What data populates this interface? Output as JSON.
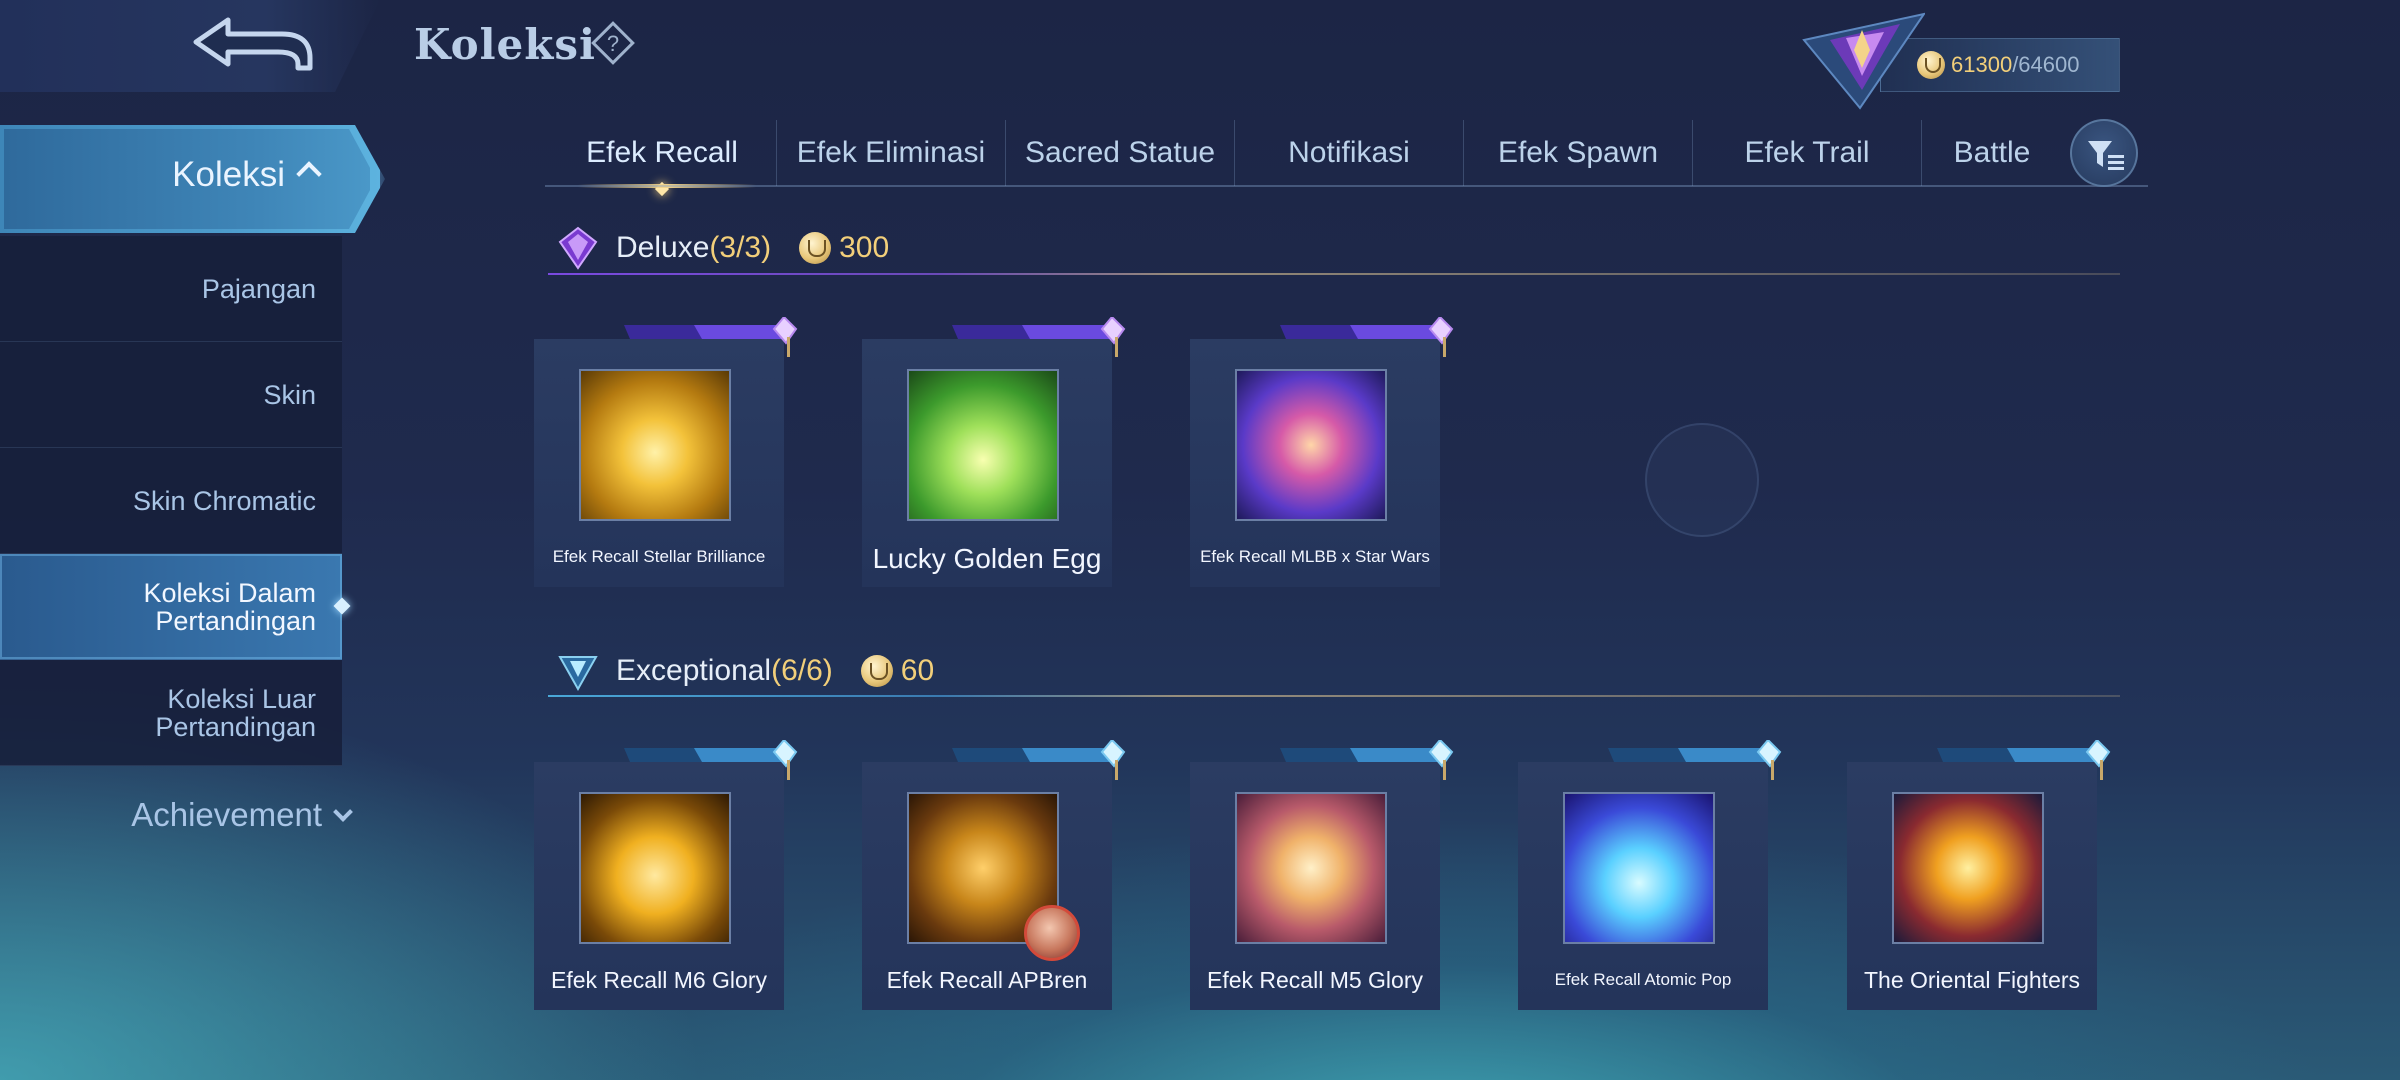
{
  "header": {
    "title": "Koleksi",
    "points_current": "61300",
    "points_max": "/64600"
  },
  "sidebar": {
    "main_label": "Koleksi",
    "items": [
      {
        "label": "Pajangan"
      },
      {
        "label": "Skin"
      },
      {
        "label": "Skin Chromatic"
      },
      {
        "label": "Koleksi Dalam Pertandingan",
        "active": true
      },
      {
        "label": "Koleksi Luar Pertandingan"
      }
    ],
    "achievement_label": "Achievement"
  },
  "tabs": [
    "Efek Recall",
    "Efek Eliminasi",
    "Sacred Statue",
    "Notifikasi",
    "Efek Spawn",
    "Efek Trail",
    "Battle"
  ],
  "active_tab": "Efek Recall",
  "sections": [
    {
      "name": "Deluxe",
      "count": "(3/3)",
      "cost": "300",
      "accent": "#8a5ad8",
      "items": [
        {
          "label": "Efek Recall Stellar Brilliance",
          "icon": "golden-swirl"
        },
        {
          "label": "Lucky Golden Egg",
          "icon": "golden-egg"
        },
        {
          "label": "Efek Recall MLBB x Star Wars",
          "icon": "crossed-lightsabers"
        }
      ]
    },
    {
      "name": "Exceptional",
      "count": "(6/6)",
      "cost": "60",
      "accent": "#4aa8d8",
      "items": [
        {
          "label": "Efek Recall M6 Glory",
          "icon": "m6-trophy"
        },
        {
          "label": "Efek Recall APBren",
          "icon": "apbren-banner",
          "has_avatar": true
        },
        {
          "label": "Efek Recall M5 Glory",
          "icon": "m5-wings"
        },
        {
          "label": "Efek Recall Atomic Pop",
          "icon": "atomic-crown"
        },
        {
          "label": "The Oriental Fighters",
          "icon": "fire-ring"
        }
      ]
    }
  ],
  "colors": {
    "gold": "#f2cf7a",
    "text": "#d8e6f5",
    "sidebar_active": "#3a78b0"
  }
}
